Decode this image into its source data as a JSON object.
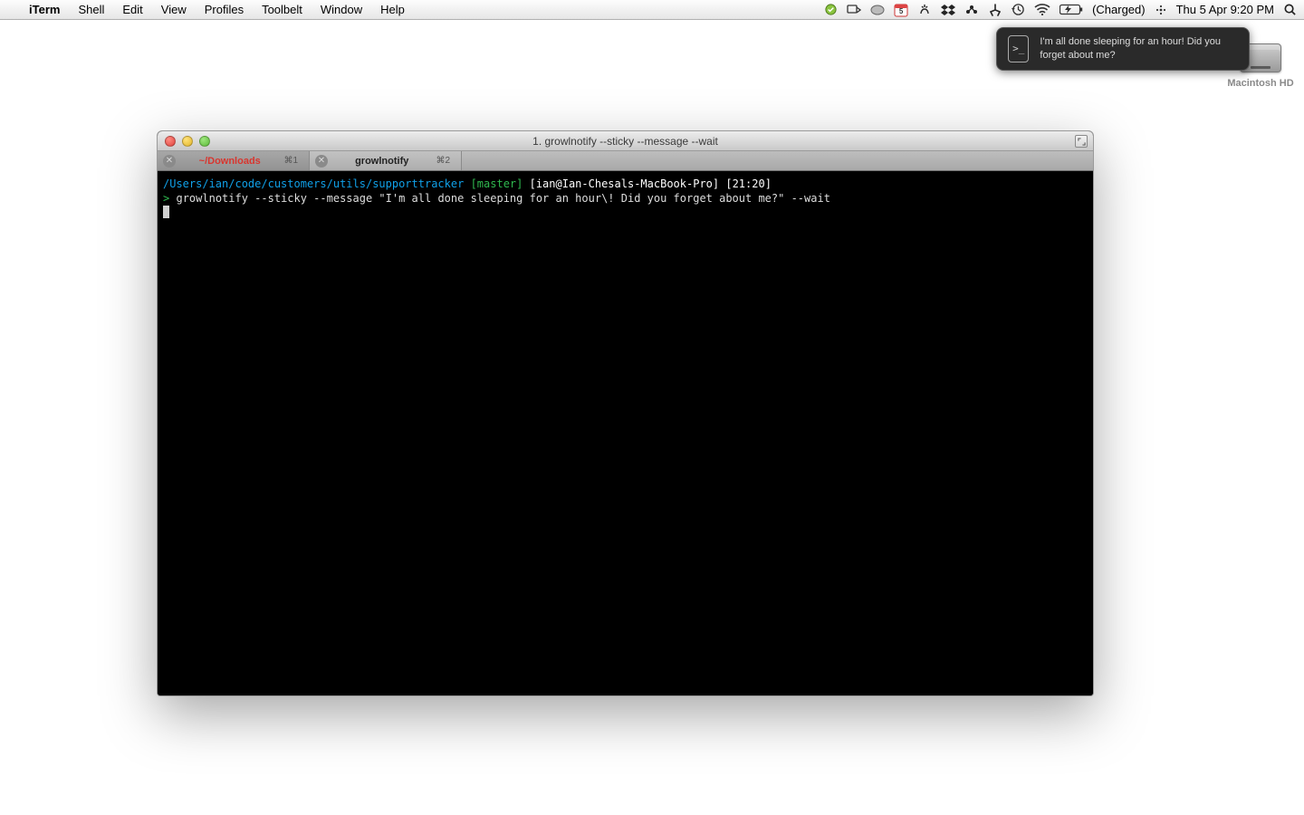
{
  "menubar": {
    "app": "iTerm",
    "items": [
      "Shell",
      "Edit",
      "View",
      "Profiles",
      "Toolbelt",
      "Window",
      "Help"
    ],
    "right": {
      "charged": "(Charged)",
      "datetime": "Thu 5 Apr  9:20 PM",
      "calendar_day": "5"
    }
  },
  "growl": {
    "message": "I'm all done sleeping for an hour! Did you forget about me?",
    "icon_glyph": ">_"
  },
  "desktop": {
    "hd_label": "Macintosh HD"
  },
  "window": {
    "title": "1. growlnotify --sticky --message  --wait",
    "tabs": [
      {
        "label": "~/Downloads",
        "shortcut": "⌘1",
        "active": false
      },
      {
        "label": "growlnotify",
        "shortcut": "⌘2",
        "active": true
      }
    ]
  },
  "terminal": {
    "prompt": {
      "path": "/Users/ian/code/customers/utils/supporttracker",
      "branch": "[master]",
      "user": "[ian@Ian-Chesals-MacBook-Pro]",
      "time": "[21:20]",
      "symbol": ">"
    },
    "command": "growlnotify --sticky --message \"I'm all done sleeping for an hour\\! Did you forget about me?\" --wait"
  }
}
